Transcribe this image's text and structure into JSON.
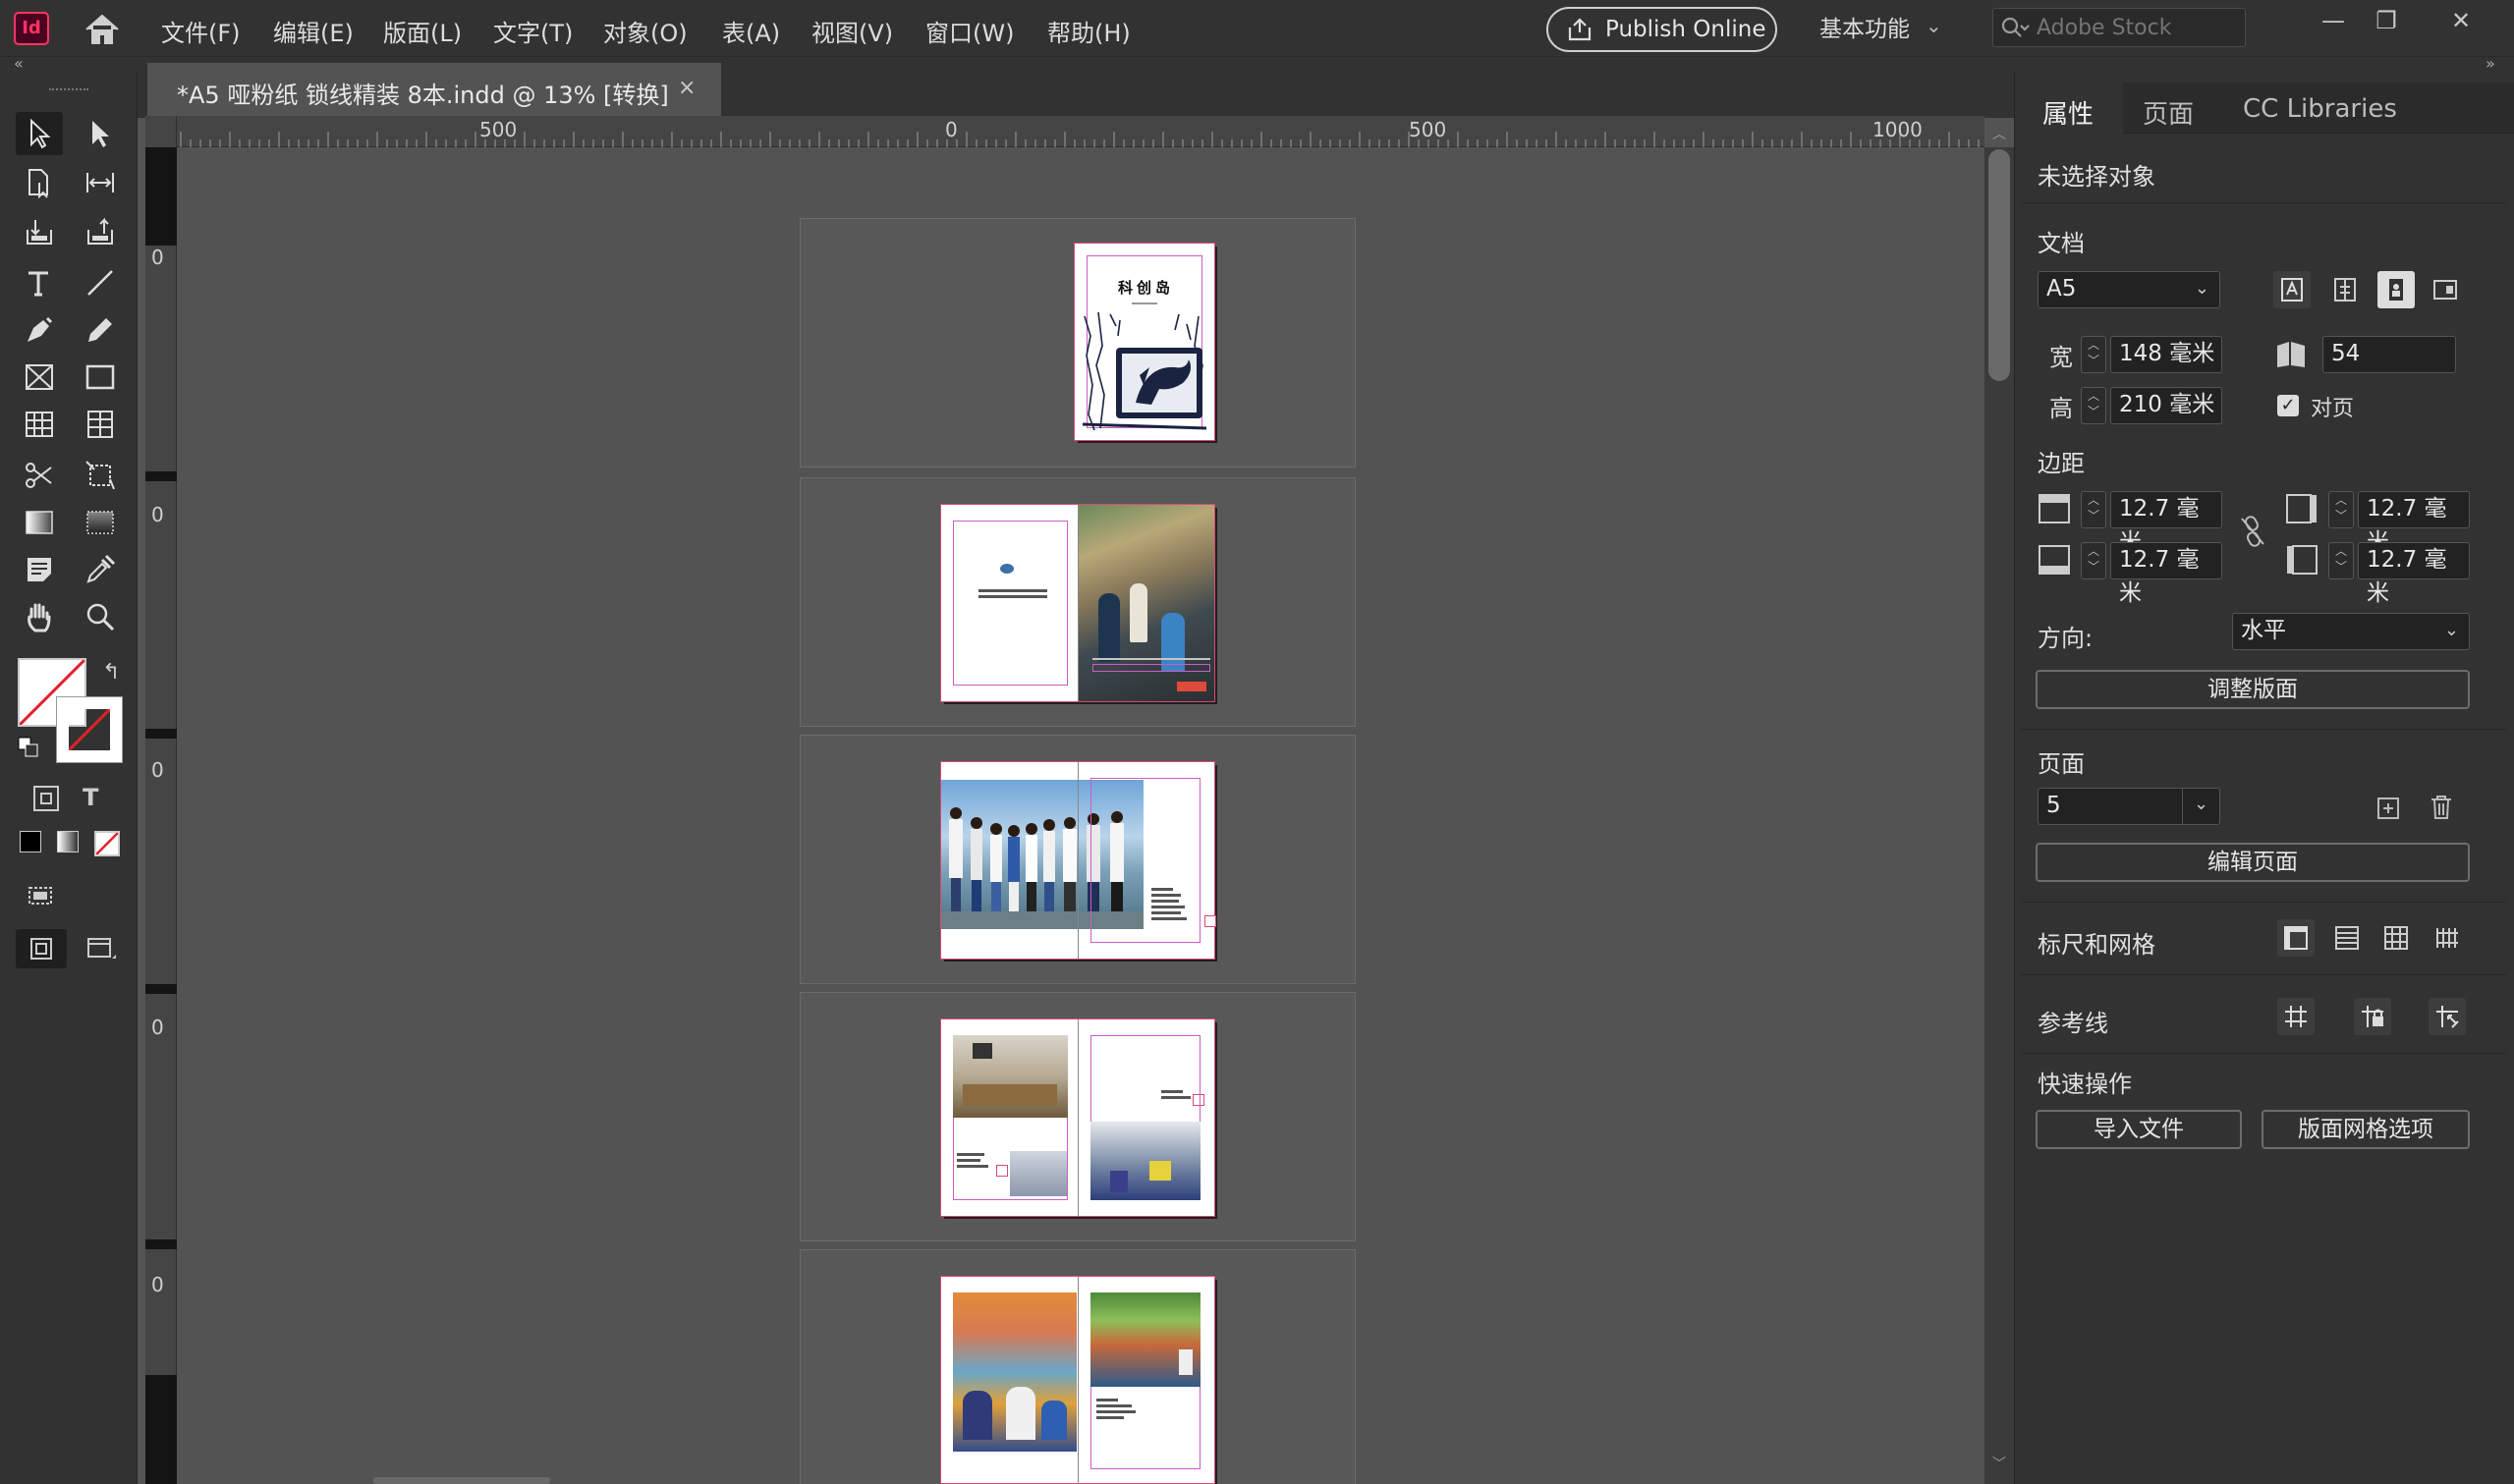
{
  "app": {
    "logo": "Id",
    "home_icon": "home-icon"
  },
  "menu": [
    "文件(F)",
    "编辑(E)",
    "版面(L)",
    "文字(T)",
    "对象(O)",
    "表(A)",
    "视图(V)",
    "窗口(W)",
    "帮助(H)"
  ],
  "publish_label": "Publish Online",
  "workspace_label": "基本功能",
  "search_placeholder": "Adobe Stock",
  "window_controls": [
    "—",
    "❐",
    "✕"
  ],
  "document_tab": {
    "title": "*A5 哑粉纸 锁线精装 8本.indd @ 13% [转换]",
    "close": "×"
  },
  "ruler": {
    "h_labels": [
      "500",
      "0",
      "500",
      "1000"
    ],
    "v_labels": [
      "0",
      "0",
      "0",
      "0",
      "0"
    ]
  },
  "pages": {
    "cover_title": "科创岛"
  },
  "panel": {
    "tabs": [
      "属性",
      "页面",
      "CC Libraries"
    ],
    "status": "未选择对象",
    "document": {
      "heading": "文档",
      "preset": "A5",
      "width_label": "宽",
      "width": "148 毫米",
      "height_label": "高",
      "height": "210 毫米",
      "pages_count": "54",
      "facing_pages_label": "对页",
      "facing_pages_checked": true
    },
    "margins": {
      "heading": "边距",
      "top": "12.7 毫米",
      "bottom": "12.7 毫米",
      "inside": "12.7 毫米",
      "outside": "12.7 毫米"
    },
    "orientation": {
      "label": "方向:",
      "value": "水平"
    },
    "adjust_layout_button": "调整版面",
    "page_section": {
      "heading": "页面",
      "current_page": "5",
      "edit_page_button": "编辑页面"
    },
    "rulers_grids_heading": "标尺和网格",
    "guides_heading": "参考线",
    "quick_actions": {
      "heading": "快速操作",
      "import_button": "导入文件",
      "grid_options_button": "版面网格选项"
    }
  }
}
